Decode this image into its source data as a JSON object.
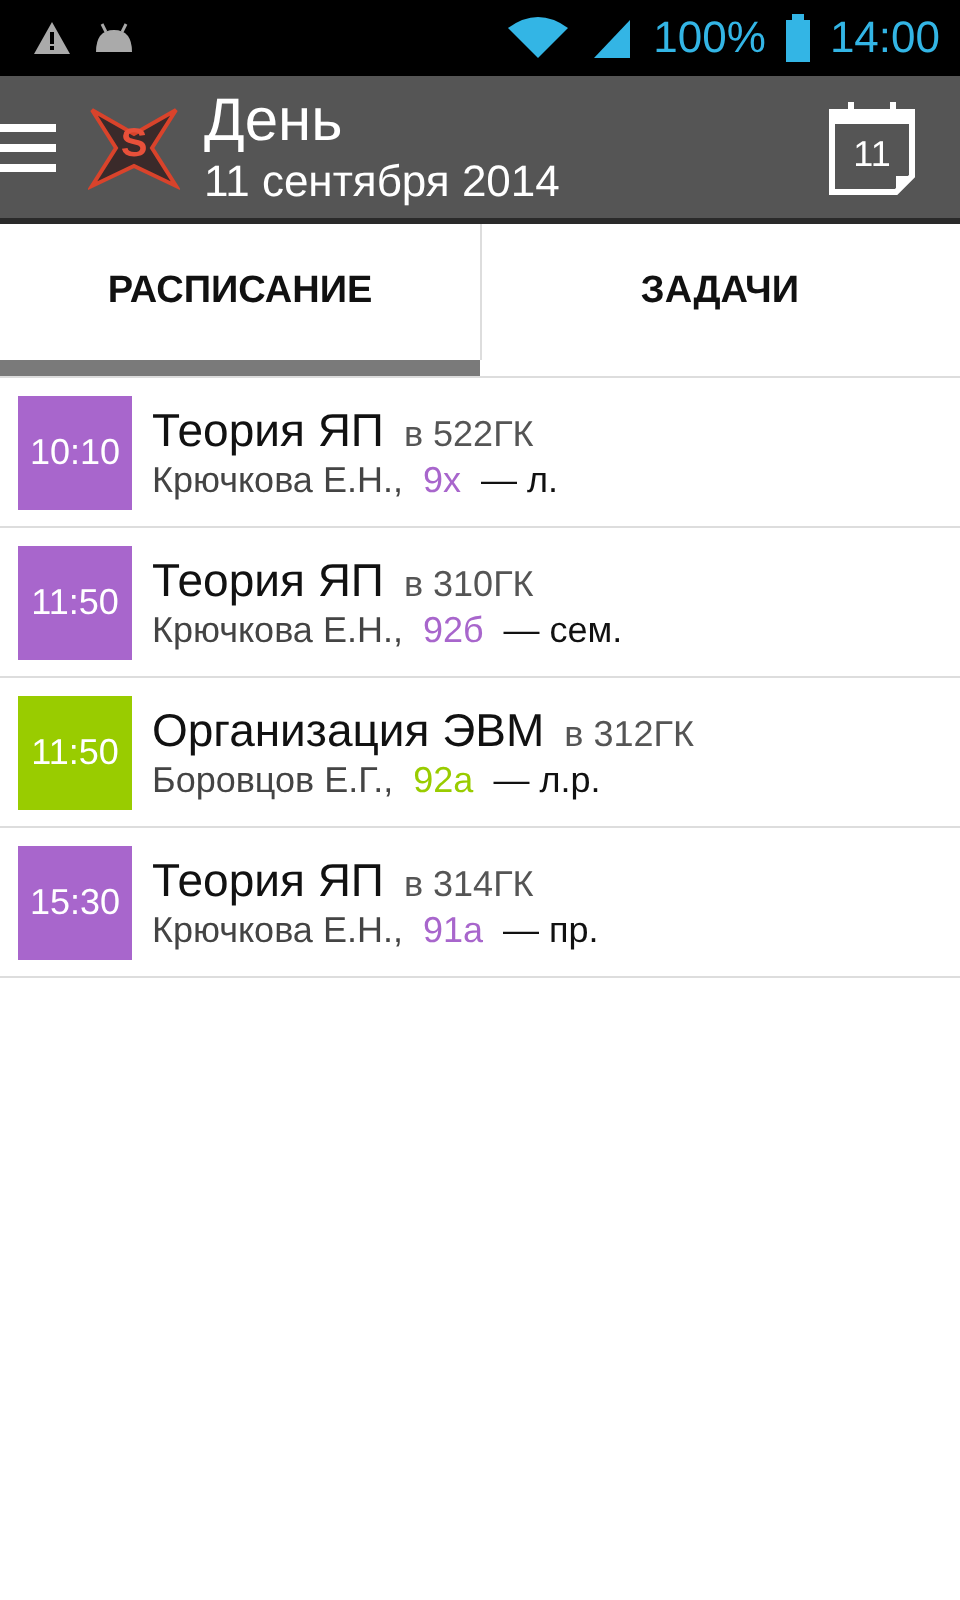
{
  "status_bar": {
    "battery": "100%",
    "time": "14:00"
  },
  "action_bar": {
    "logo_letter": "S",
    "title": "День",
    "subtitle": "11 сентября 2014",
    "calendar_day": "11"
  },
  "tabs": [
    {
      "label": "РАСПИСАНИЕ",
      "selected": true
    },
    {
      "label": "ЗАДАЧИ",
      "selected": false
    }
  ],
  "lessons": [
    {
      "time": "10:10",
      "color": "#a866cc",
      "subject": "Теория ЯП",
      "room": "в 522ГК",
      "teacher": "Крючкова Е.Н.,",
      "group": "9х",
      "type": "— л."
    },
    {
      "time": "11:50",
      "color": "#a866cc",
      "subject": "Теория ЯП",
      "room": "в 310ГК",
      "teacher": "Крючкова Е.Н.,",
      "group": "92б",
      "type": "— сем."
    },
    {
      "time": "11:50",
      "color": "#99cc00",
      "subject": "Организация ЭВМ",
      "room": "в 312ГК",
      "teacher": "Боровцов Е.Г.,",
      "group": "92а",
      "type": "— л.р."
    },
    {
      "time": "15:30",
      "color": "#a866cc",
      "subject": "Теория ЯП",
      "room": "в 314ГК",
      "teacher": "Крючкова Е.Н.,",
      "group": "91а",
      "type": "— пр."
    }
  ]
}
